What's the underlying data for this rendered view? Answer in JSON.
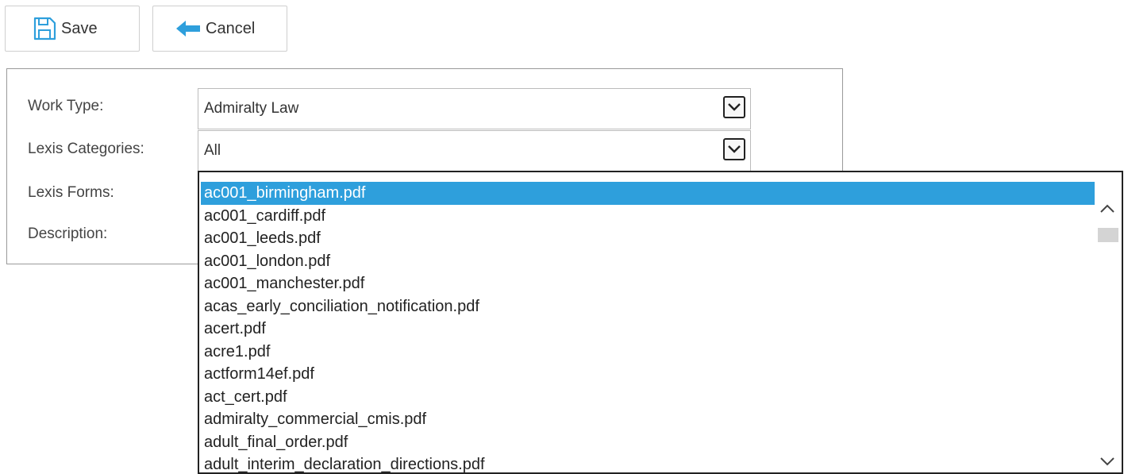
{
  "toolbar": {
    "save_label": "Save",
    "cancel_label": "Cancel"
  },
  "form": {
    "work_type": {
      "label": "Work Type:",
      "value": "Admiralty Law"
    },
    "lexis_categories": {
      "label": "Lexis Categories:",
      "value": "All"
    },
    "lexis_forms": {
      "label": "Lexis Forms:"
    },
    "description": {
      "label": "Description:"
    }
  },
  "dropdown": {
    "items": [
      "ac001_birmingham.pdf",
      "ac001_cardiff.pdf",
      "ac001_leeds.pdf",
      "ac001_london.pdf",
      "ac001_manchester.pdf",
      "acas_early_conciliation_notification.pdf",
      "acert.pdf",
      "acre1.pdf",
      "actform14ef.pdf",
      "act_cert.pdf",
      "admiralty_commercial_cmis.pdf",
      "adult_final_order.pdf",
      "adult_interim_declaration_directions.pdf"
    ],
    "selected_index": 0
  },
  "colors": {
    "selection": "#2e9fdc",
    "icon_blue": "#2e9fdc"
  },
  "icons": {
    "save": "floppy-disk-icon",
    "cancel": "arrow-left-icon",
    "dropdown": "chevron-down-icon",
    "scroll_up": "chevron-up-icon",
    "scroll_down": "chevron-down-icon"
  }
}
